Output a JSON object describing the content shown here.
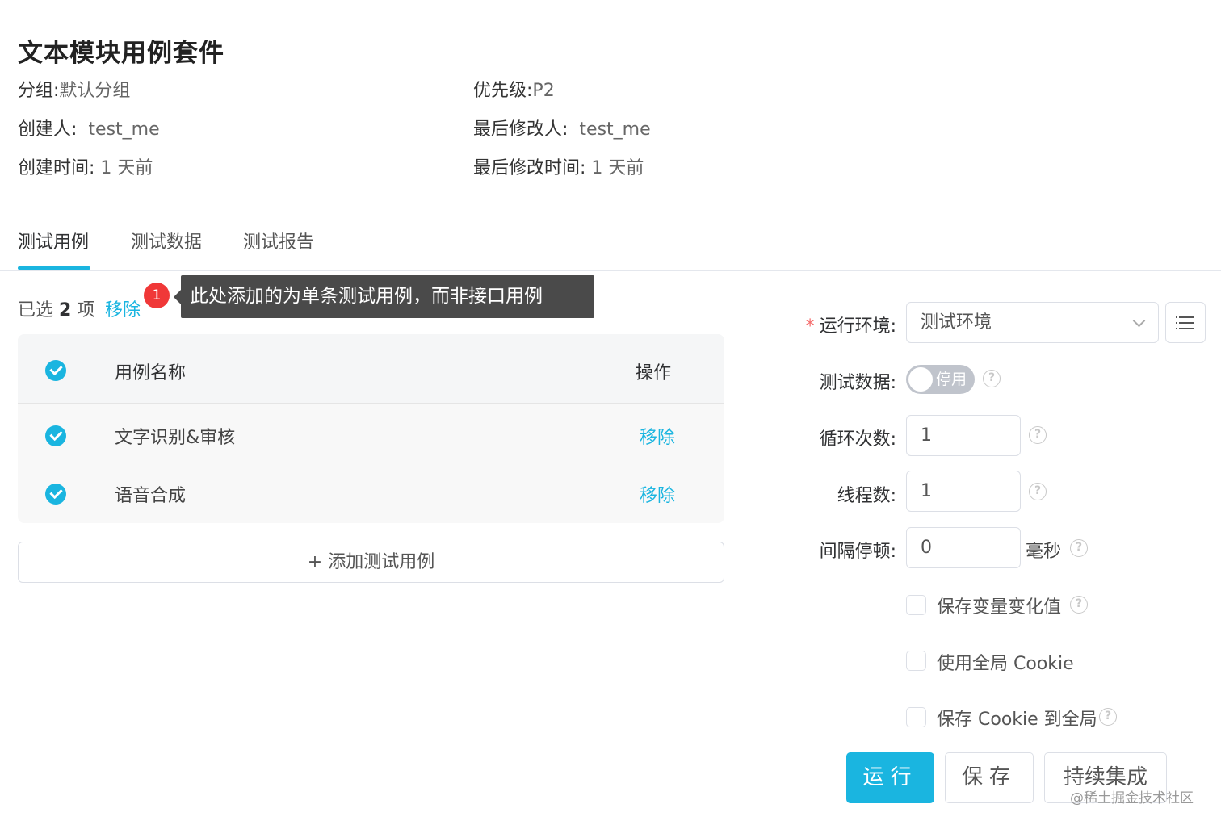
{
  "page": {
    "title": "文本模块用例套件"
  },
  "meta": {
    "group_label": "分组:",
    "group_value": "默认分组",
    "priority_label": "优先级:",
    "priority_value": "P2",
    "creator_label": "创建人:",
    "creator_value": "test_me",
    "modifier_label": "最后修改人:",
    "modifier_value": "test_me",
    "created_label": "创建时间:",
    "created_value": "1 天前",
    "modified_label": "最后修改时间:",
    "modified_value": "1 天前"
  },
  "tabs": [
    {
      "label": "测试用例",
      "active": true
    },
    {
      "label": "测试数据",
      "active": false
    },
    {
      "label": "测试报告",
      "active": false
    }
  ],
  "selection": {
    "prefix": "已选",
    "count": "2",
    "suffix": "项",
    "remove_label": "移除"
  },
  "annotation": {
    "badge": "1",
    "tooltip": "此处添加的为单条测试用例，而非接口用例"
  },
  "table": {
    "headers": {
      "name": "用例名称",
      "op": "操作"
    },
    "rows": [
      {
        "name": "文字识别&审核",
        "op": "移除"
      },
      {
        "name": "语音合成",
        "op": "移除"
      }
    ]
  },
  "add_button": "+ 添加测试用例",
  "form": {
    "env_label": "运行环境:",
    "env_required": "*",
    "env_value": "测试环境",
    "testdata_label": "测试数据:",
    "testdata_switch": "停用",
    "loops_label": "循环次数:",
    "loops_value": "1",
    "threads_label": "线程数:",
    "threads_value": "1",
    "interval_label": "间隔停顿:",
    "interval_value": "0",
    "interval_unit": "毫秒",
    "save_vars_label": "保存变量变化值",
    "global_cookie_label": "使用全局 Cookie",
    "save_cookie_label": "保存 Cookie 到全局",
    "help_glyph": "?"
  },
  "actions": {
    "run": "运行",
    "save": "保存",
    "ci": "持续集成"
  },
  "watermark": "@稀土掘金技术社区",
  "colors": {
    "accent": "#1ab5e0",
    "badge": "#f03838",
    "tooltip_bg": "#4a4a4a"
  }
}
